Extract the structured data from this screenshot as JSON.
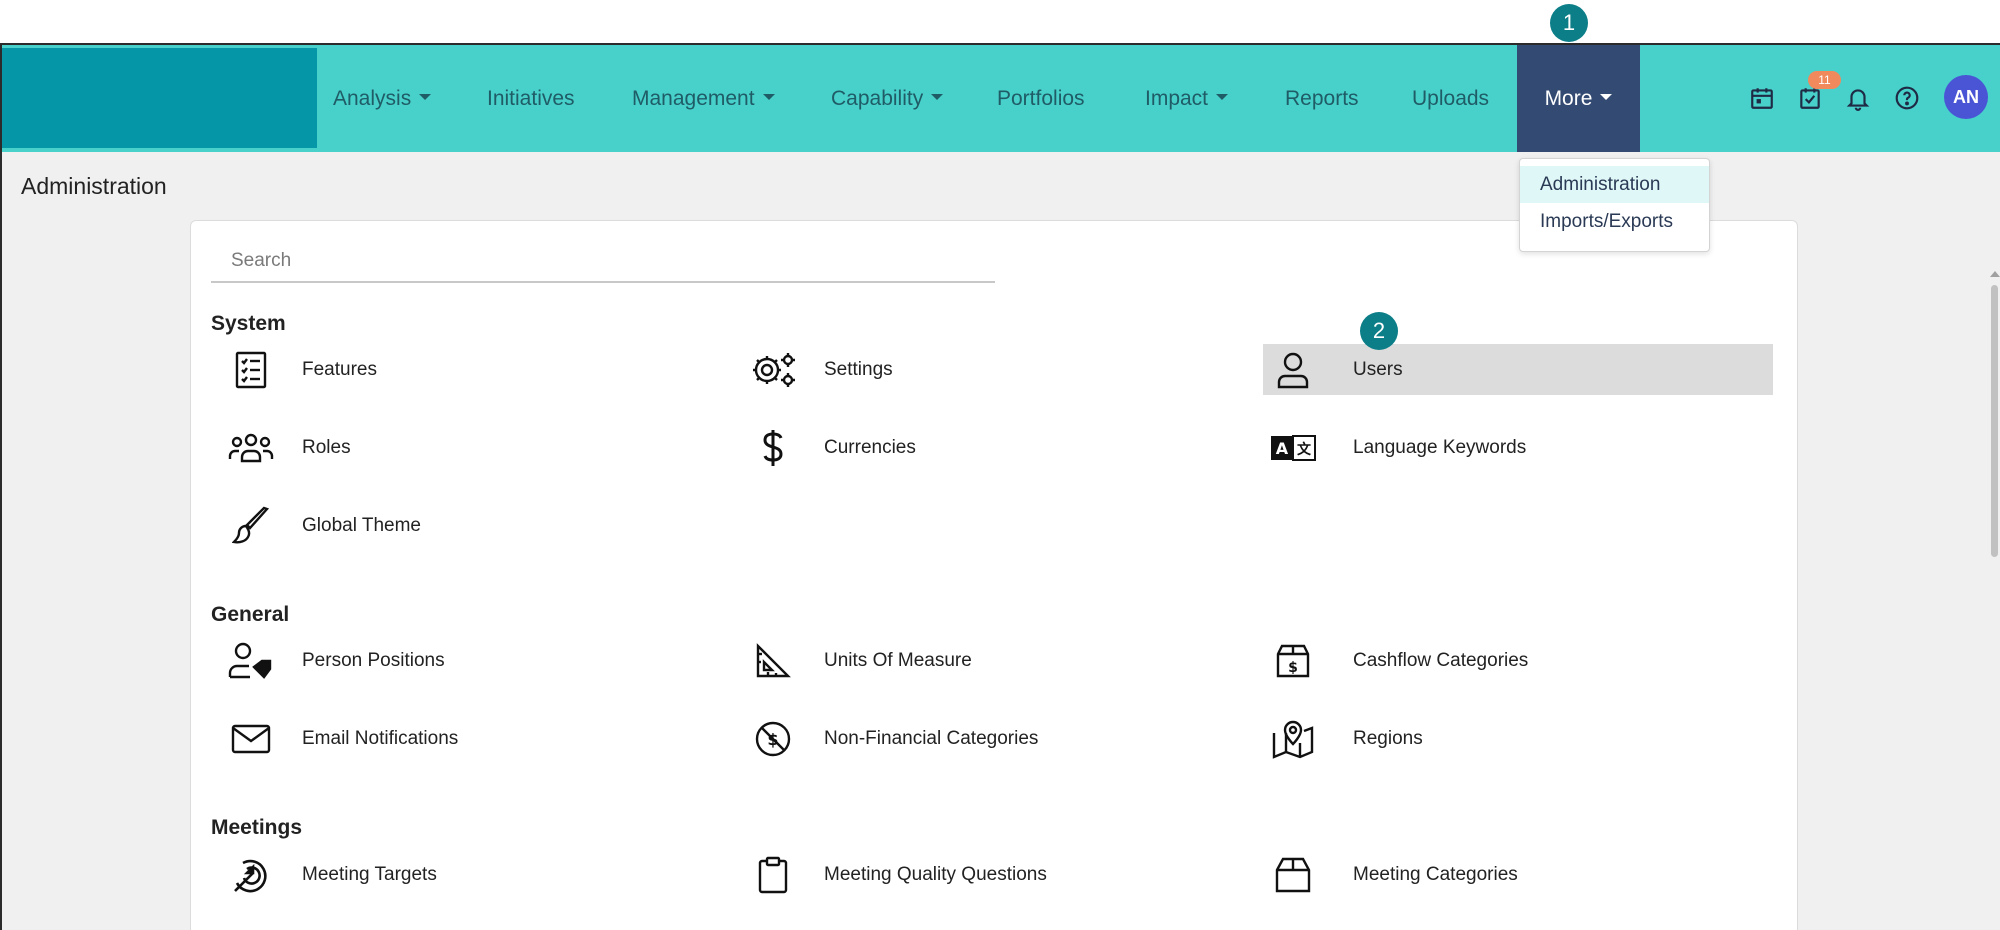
{
  "nav": {
    "items": [
      {
        "label": "Analysis",
        "has_caret": true
      },
      {
        "label": "Initiatives",
        "has_caret": false
      },
      {
        "label": "Management",
        "has_caret": true
      },
      {
        "label": "Capability",
        "has_caret": true
      },
      {
        "label": "Portfolios",
        "has_caret": false
      },
      {
        "label": "Impact",
        "has_caret": true
      },
      {
        "label": "Reports",
        "has_caret": false
      },
      {
        "label": "Uploads",
        "has_caret": false
      },
      {
        "label": "More",
        "has_caret": true
      }
    ],
    "icons": [
      "calendar-icon",
      "task-check-icon",
      "bell-icon",
      "help-icon"
    ],
    "task_badge_count": "11",
    "avatar_initials": "AN",
    "colors": {
      "topbar": "#48d1cb",
      "brand": "#0596a7",
      "active": "#334a72",
      "avatar": "#4a55d6",
      "badge": "#f08a5d"
    }
  },
  "steps": {
    "one": "1",
    "two": "2"
  },
  "more_menu": {
    "items": [
      {
        "label": "Administration",
        "active": true
      },
      {
        "label": "Imports/Exports",
        "active": false
      }
    ]
  },
  "page": {
    "title": "Administration",
    "search_placeholder": "Search"
  },
  "sections": [
    {
      "title": "System",
      "items": [
        {
          "label": "Features",
          "icon": "checklist-icon"
        },
        {
          "label": "Settings",
          "icon": "gears-icon"
        },
        {
          "label": "Users",
          "icon": "user-icon",
          "selected": true
        },
        {
          "label": "Roles",
          "icon": "people-group-icon"
        },
        {
          "label": "Currencies",
          "icon": "dollar-icon"
        },
        {
          "label": "Language Keywords",
          "icon": "translate-icon"
        },
        {
          "label": "Global Theme",
          "icon": "paintbrush-icon"
        }
      ]
    },
    {
      "title": "General",
      "items": [
        {
          "label": "Person Positions",
          "icon": "person-tag-icon"
        },
        {
          "label": "Units Of Measure",
          "icon": "ruler-triangle-icon"
        },
        {
          "label": "Cashflow Categories",
          "icon": "money-box-icon"
        },
        {
          "label": "Email Notifications",
          "icon": "envelope-icon"
        },
        {
          "label": "Non-Financial Categories",
          "icon": "no-dollar-icon"
        },
        {
          "label": "Regions",
          "icon": "map-pin-icon"
        }
      ]
    },
    {
      "title": "Meetings",
      "items": [
        {
          "label": "Meeting Targets",
          "icon": "target-arrow-icon"
        },
        {
          "label": "Meeting Quality Questions",
          "icon": "clipboard-icon"
        },
        {
          "label": "Meeting Categories",
          "icon": "box-icon"
        }
      ]
    }
  ]
}
